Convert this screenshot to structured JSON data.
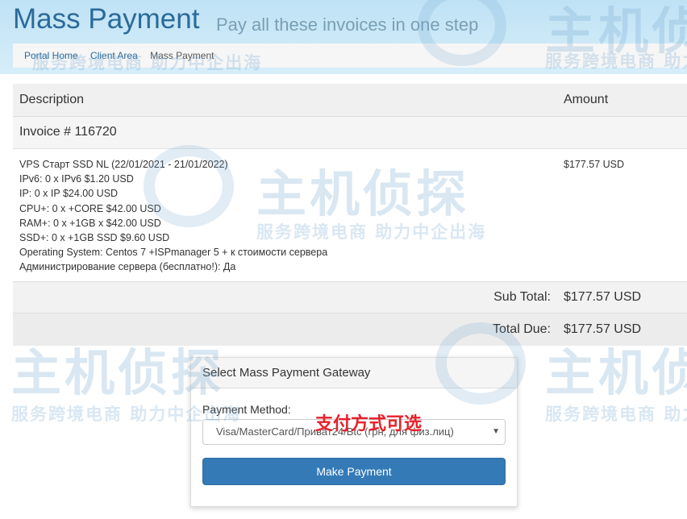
{
  "header": {
    "title": "Mass Payment",
    "subtitle": "Pay all these invoices in one step"
  },
  "breadcrumb": {
    "items": [
      "Portal Home",
      "Client Area",
      "Mass Payment"
    ]
  },
  "table": {
    "headers": {
      "description": "Description",
      "amount": "Amount"
    },
    "invoice_number": "Invoice # 116720",
    "items": [
      "VPS Старт SSD NL (22/01/2021 - 21/01/2022)",
      "IPv6: 0 x IPv6 $1.20 USD",
      "IP: 0 x IP $24.00 USD",
      "CPU+: 0 x +CORE $42.00 USD",
      "RAM+: 0 x +1GB x $42.00 USD",
      "SSD+: 0 x +1GB SSD $9.60 USD",
      "Operating System: Centos 7 +ISPmanager 5 + к стоимости сервера",
      "Администрирование сервера (бесплатно!): Да"
    ],
    "item_amount": "$177.57 USD",
    "subtotal_label": "Sub Total:",
    "subtotal_value": "$177.57 USD",
    "total_label": "Total Due:",
    "total_value": "$177.57 USD"
  },
  "gateway": {
    "title": "Select Mass Payment Gateway",
    "method_label": "Payment Method:",
    "selected_method": "Visa/MasterCard/Приват24/Btc (грн, для физ.лиц)",
    "annotation": "支付方式可选",
    "button_label": "Make Payment"
  },
  "watermark": {
    "brand": "主机侦探",
    "slogan": "服务跨境电商 助力中企出海"
  },
  "icons": {
    "select_caret": "caret-down-icon"
  },
  "colors": {
    "accent": "#337ab7",
    "title": "#2a6a9a",
    "annotation": "#e8202a"
  }
}
